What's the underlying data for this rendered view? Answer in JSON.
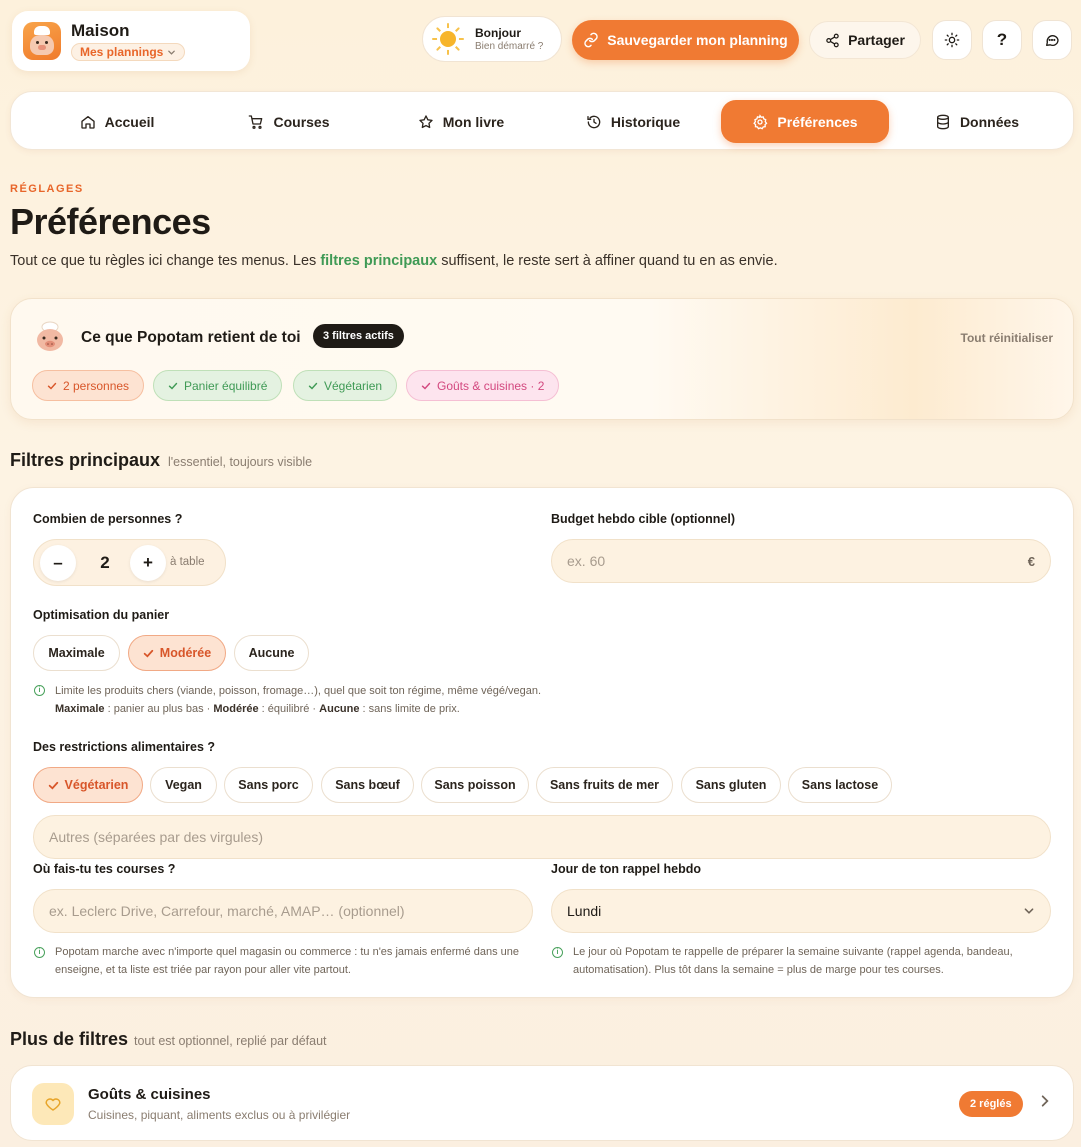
{
  "header": {
    "brand_name": "Maison",
    "brand_switcher": "Mes plannings",
    "greeting_title": "Bonjour",
    "greeting_sub": "Bien démarré ?",
    "save_label": "Sauvegarder mon planning",
    "share_label": "Partager",
    "help_label": "?"
  },
  "nav": {
    "items": [
      {
        "label": "Accueil",
        "icon": "home-icon"
      },
      {
        "label": "Courses",
        "icon": "cart-icon"
      },
      {
        "label": "Mon livre",
        "icon": "star-icon"
      },
      {
        "label": "Historique",
        "icon": "history-icon"
      },
      {
        "label": "Préférences",
        "icon": "gear-icon",
        "active": true
      },
      {
        "label": "Données",
        "icon": "database-icon"
      }
    ]
  },
  "page": {
    "eyebrow": "RÉGLAGES",
    "title": "Préférences",
    "intro_before": "Tout ce que tu règles ici change tes menus. Les ",
    "intro_highlight": "filtres principaux",
    "intro_after": " suffisent, le reste sert à affiner quand tu en as envie."
  },
  "summary": {
    "title": "Ce que Popotam retient de toi",
    "badge": "3 filtres actifs",
    "reset": "Tout réinitialiser",
    "chips": [
      {
        "label": "2 personnes",
        "tone": "orange"
      },
      {
        "label": "Panier équilibré",
        "tone": "green"
      },
      {
        "label": "Végétarien",
        "tone": "green"
      },
      {
        "label": "Goûts & cuisines · 2",
        "tone": "pink"
      }
    ]
  },
  "main_filters": {
    "title": "Filtres principaux",
    "subtitle": "l'essentiel, toujours visible",
    "people_label": "Combien de personnes ?",
    "people_value": "2",
    "people_unit": "à table",
    "minus": "–",
    "plus": "+",
    "budget_label": "Budget hebdo cible (optionnel)",
    "budget_placeholder": "ex. 60",
    "budget_currency": "€",
    "basket_label": "Optimisation du panier",
    "basket_options": [
      "Maximale",
      "Modérée",
      "Aucune"
    ],
    "basket_selected": "Modérée",
    "basket_hint_line1": "Limite les produits chers (viande, poisson, fromage…), quel que soit ton régime, même végé/vegan.",
    "basket_hint_b1": "Maximale",
    "basket_hint_t1": " : panier au plus bas · ",
    "basket_hint_b2": "Modérée",
    "basket_hint_t2": " : équilibré · ",
    "basket_hint_b3": "Aucune",
    "basket_hint_t3": " : sans limite de prix.",
    "diet_label": "Des restrictions alimentaires ?",
    "diet_options": [
      "Végétarien",
      "Vegan",
      "Sans porc",
      "Sans bœuf",
      "Sans poisson",
      "Sans fruits de mer",
      "Sans gluten",
      "Sans lactose"
    ],
    "diet_selected": "Végétarien",
    "diet_other_placeholder": "Autres (séparées par des virgules)",
    "store_label": "Où fais-tu tes courses ?",
    "store_placeholder": "ex. Leclerc Drive, Carrefour, marché, AMAP… (optionnel)",
    "store_hint": "Popotam marche avec n'importe quel magasin ou commerce : tu n'es jamais enfermé dans une enseigne, et ta liste est triée par rayon pour aller vite partout.",
    "reminder_label": "Jour de ton rappel hebdo",
    "reminder_value": "Lundi",
    "reminder_hint": "Le jour où Popotam te rappelle de préparer la semaine suivante (rappel agenda, bandeau, automatisation). Plus tôt dans la semaine = plus de marge pour tes courses."
  },
  "more_filters": {
    "title": "Plus de filtres",
    "subtitle": "tout est optionnel, replié par défaut",
    "goals_title": "Goûts & cuisines",
    "goals_sub": "Cuisines, piquant, aliments exclus ou à privilégier",
    "goals_badge": "2 réglés"
  },
  "colors": {
    "accent": "#f07a33",
    "green": "#3f9a55",
    "pink": "#d3487f"
  }
}
